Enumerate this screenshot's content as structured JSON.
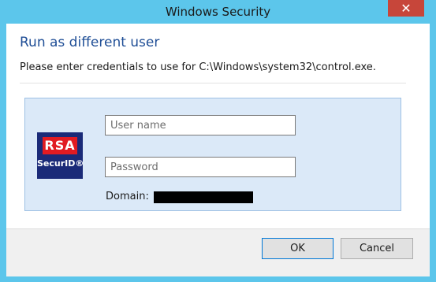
{
  "window": {
    "title": "Windows Security",
    "close_label": "✕"
  },
  "dialog": {
    "heading": "Run as different user",
    "subtext": "Please enter credentials to use for C:\\Windows\\system32\\control.exe."
  },
  "logo": {
    "brand_top": "RSA",
    "brand_bottom": "SecurID®"
  },
  "form": {
    "username_placeholder": "User name",
    "username_value": "",
    "password_placeholder": "Password",
    "password_value": "",
    "domain_label": "Domain:",
    "domain_value_redacted": true
  },
  "buttons": {
    "ok_label": "OK",
    "cancel_label": "Cancel"
  },
  "colors": {
    "titlebar": "#5cc6eb",
    "close_button": "#c7463a",
    "heading_text": "#1f4e96",
    "panel_bg": "#dbe9f8",
    "panel_border": "#9ec0e4",
    "rsa_red": "#e11b22",
    "rsa_navy": "#1a2a78"
  }
}
